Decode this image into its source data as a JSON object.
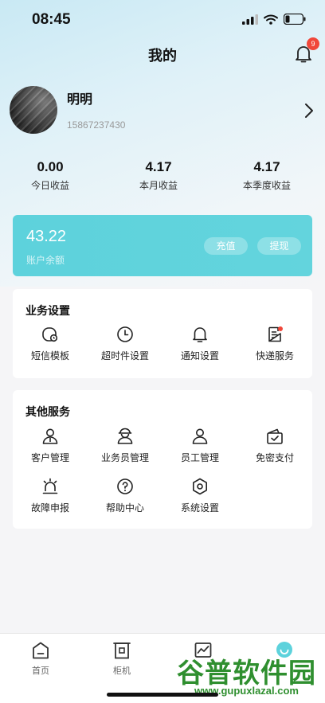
{
  "status_bar": {
    "time": "08:45"
  },
  "header": {
    "title": "我的",
    "notification_count": "9"
  },
  "profile": {
    "name": "明明",
    "phone": "15867237430"
  },
  "stats": [
    {
      "value": "0.00",
      "label": "今日收益"
    },
    {
      "value": "4.17",
      "label": "本月收益"
    },
    {
      "value": "4.17",
      "label": "本季度收益"
    }
  ],
  "balance": {
    "value": "43.22",
    "label": "账户余额",
    "recharge_label": "充值",
    "withdraw_label": "提现"
  },
  "business_settings": {
    "title": "业务设置",
    "items": [
      {
        "label": "短信模板",
        "icon": "sms-template-icon"
      },
      {
        "label": "超时件设置",
        "icon": "clock-icon"
      },
      {
        "label": "通知设置",
        "icon": "bell-icon"
      },
      {
        "label": "快递服务",
        "icon": "express-doc-icon"
      }
    ]
  },
  "other_services": {
    "title": "其他服务",
    "items": [
      {
        "label": "客户管理",
        "icon": "customer-icon"
      },
      {
        "label": "业务员管理",
        "icon": "courier-icon"
      },
      {
        "label": "员工管理",
        "icon": "staff-icon"
      },
      {
        "label": "免密支付",
        "icon": "wallet-check-icon"
      },
      {
        "label": "故障申报",
        "icon": "alarm-light-icon"
      },
      {
        "label": "帮助中心",
        "icon": "help-icon"
      },
      {
        "label": "系统设置",
        "icon": "hex-gear-icon"
      }
    ]
  },
  "tabbar": {
    "items": [
      {
        "label": "首页",
        "icon": "home-icon"
      },
      {
        "label": "柜机",
        "icon": "cabinet-icon"
      },
      {
        "label": "",
        "icon": "chart-icon"
      },
      {
        "label": "",
        "icon": "profile-tab-icon"
      }
    ]
  },
  "watermark": {
    "main": "谷普软件园",
    "sub": "www.gupuxlazal.com"
  },
  "colors": {
    "accent": "#5dd2dc",
    "badge": "#f0473a",
    "watermark": "#2f8f2f"
  }
}
